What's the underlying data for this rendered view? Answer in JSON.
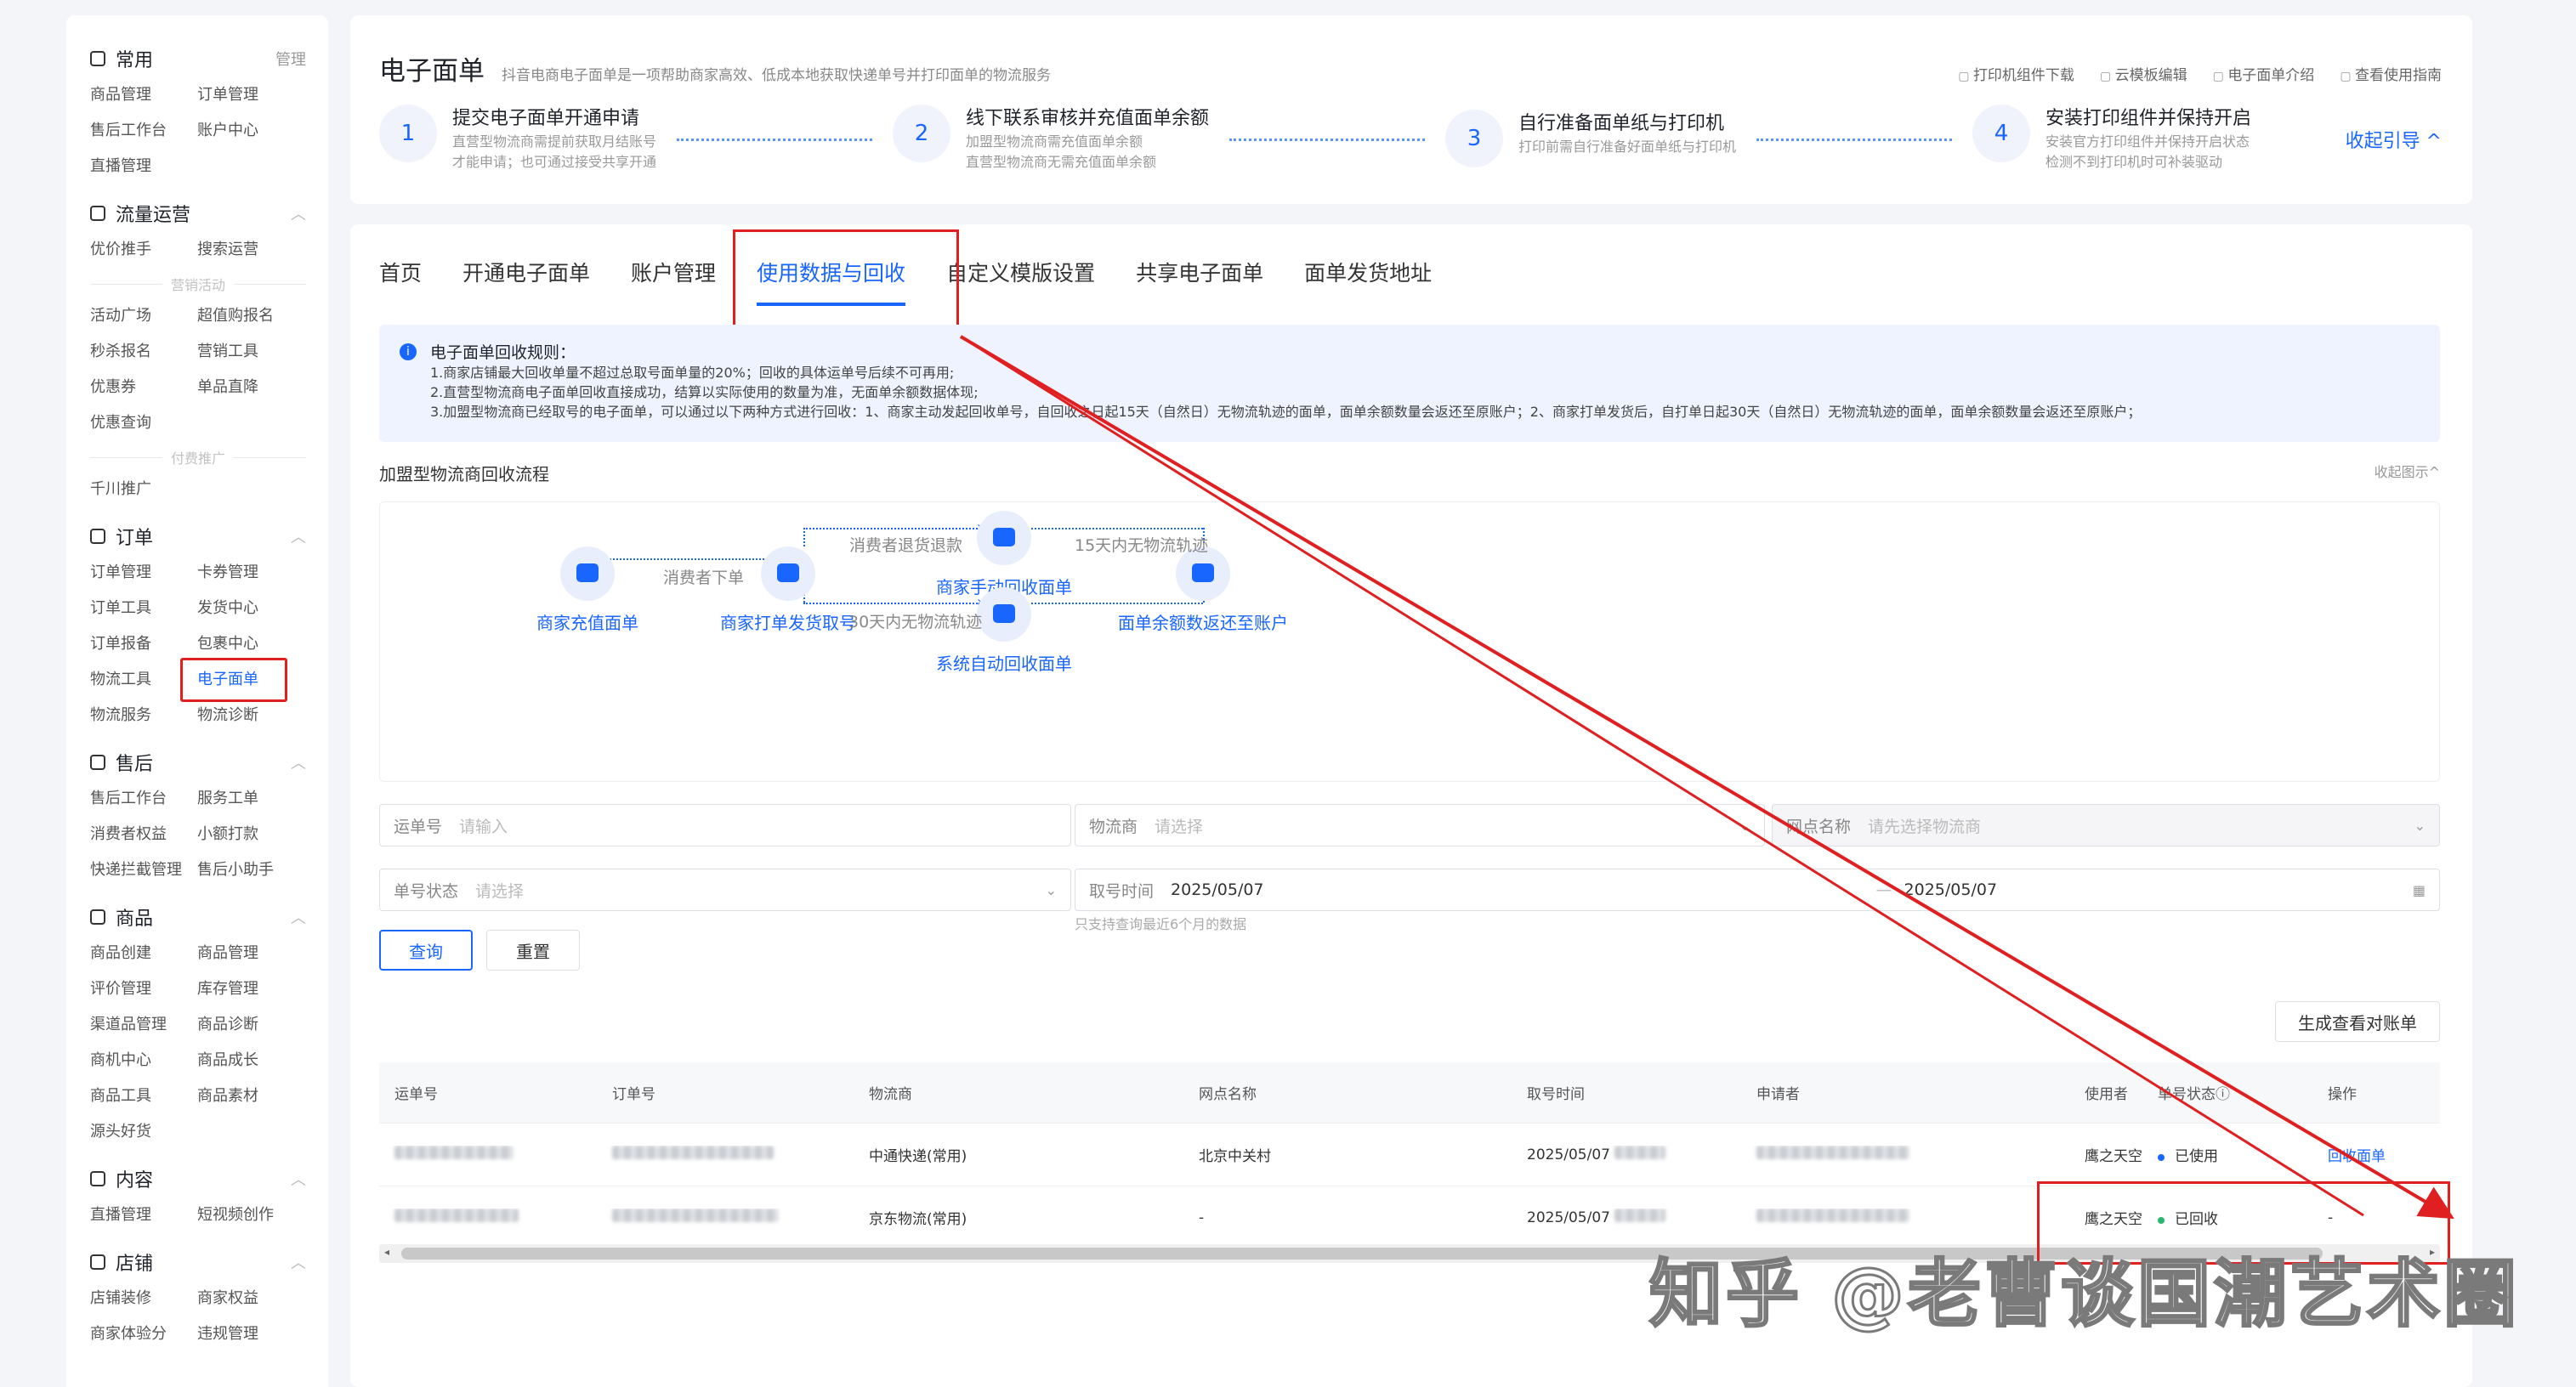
{
  "sidebar": {
    "common": {
      "title": "常用",
      "right": "管理",
      "items": [
        "商品管理",
        "订单管理",
        "售后工作台",
        "账户中心",
        "直播管理"
      ]
    },
    "traffic": {
      "title": "流量运营",
      "items1": [
        "优价推手",
        "搜索运营"
      ],
      "sub1": "营销活动",
      "items2": [
        "活动广场",
        "超值购报名",
        "秒杀报名",
        "营销工具",
        "优惠券",
        "单品直降",
        "优惠查询"
      ],
      "sub2": "付费推广",
      "items3": [
        "千川推广"
      ]
    },
    "order": {
      "title": "订单",
      "items": [
        "订单管理",
        "卡券管理",
        "订单工具",
        "发货中心",
        "订单报备",
        "包裹中心",
        "物流工具",
        "电子面单",
        "物流服务",
        "物流诊断"
      ]
    },
    "aftersale": {
      "title": "售后",
      "items": [
        "售后工作台",
        "服务工单",
        "消费者权益",
        "小额打款",
        "快递拦截管理",
        "售后小助手"
      ]
    },
    "goods": {
      "title": "商品",
      "items": [
        "商品创建",
        "商品管理",
        "评价管理",
        "库存管理",
        "渠道品管理",
        "商品诊断",
        "商机中心",
        "商品成长",
        "商品工具",
        "商品素材",
        "源头好货"
      ]
    },
    "content": {
      "title": "内容",
      "items": [
        "直播管理",
        "短视频创作"
      ]
    },
    "shop": {
      "title": "店铺",
      "items": [
        "店铺装修",
        "商家权益",
        "商家体验分",
        "违规管理"
      ]
    }
  },
  "top": {
    "title": "电子面单",
    "desc": "抖音电商电子面单是一项帮助商家高效、低成本地获取快递单号并打印面单的物流服务",
    "links": [
      "打印机组件下载",
      "云模板编辑",
      "电子面单介绍",
      "查看使用指南"
    ],
    "steps": [
      {
        "num": "1",
        "title": "提交电子面单开通申请",
        "desc1": "直营型物流商需提前获取月结账号",
        "desc2": "才能申请；也可通过接受共享开通"
      },
      {
        "num": "2",
        "title": "线下联系审核并充值面单余额",
        "desc1": "加盟型物流商需充值面单余额",
        "desc2": "直营型物流商无需充值面单余额"
      },
      {
        "num": "3",
        "title": "自行准备面单纸与打印机",
        "desc1": "打印前需自行准备好面单纸与打印机",
        "desc2": ""
      },
      {
        "num": "4",
        "title": "安装打印组件并保持开启",
        "desc1": "安装官方打印组件并保持开启状态",
        "desc2": "检测不到打印机时可补装驱动"
      }
    ],
    "collapse": "收起引导 ^"
  },
  "tabs": [
    "首页",
    "开通电子面单",
    "账户管理",
    "使用数据与回收",
    "自定义模版设置",
    "共享电子面单",
    "面单发货地址"
  ],
  "notice": {
    "title": "电子面单回收规则：",
    "lines": [
      "1.商家店铺最大回收单量不超过总取号面单量的20%；回收的具体运单号后续不可再用;",
      "2.直营型物流商电子面单回收直接成功，结算以实际使用的数量为准，无面单余额数据体现;",
      "3.加盟型物流商已经取号的电子面单，可以通过以下两种方式进行回收：1、商家主动发起回收单号，自回收之日起15天（自然日）无物流轨迹的面单，面单余额数量会返还至原账户；2、商家打单发货后，自打单日起30天（自然日）无物流轨迹的面单，面单余额数量会返还至原账户；"
    ]
  },
  "flow": {
    "title": "加盟型物流商回收流程",
    "collapse": "收起图示^",
    "nodes": {
      "recharge": "商家充值面单",
      "print": "商家打单发货取号",
      "manual": "商家手动回收面单",
      "auto": "系统自动回收面单",
      "return": "面单余额数返还至账户"
    },
    "labels": {
      "order": "消费者下单",
      "refund": "消费者退货退款",
      "no15": "15天内无物流轨迹",
      "no30": "30天内无物流轨迹"
    }
  },
  "filters": {
    "waybill": {
      "label": "运单号",
      "placeholder": "请输入"
    },
    "carrier": {
      "label": "物流商",
      "placeholder": "请选择"
    },
    "site": {
      "label": "网点名称",
      "placeholder": "请先选择物流商"
    },
    "status": {
      "label": "单号状态",
      "placeholder": "请选择"
    },
    "time": {
      "label": "取号时间",
      "start": "2025/05/07",
      "sep": "—",
      "end": "2025/05/07"
    },
    "hint": "只支持查询最近6个月的数据",
    "query": "查询",
    "reset": "重置",
    "bill": "生成查看对账单"
  },
  "table": {
    "headers": [
      "运单号",
      "订单号",
      "物流商",
      "网点名称",
      "取号时间",
      "申请者",
      "使用者",
      "单号状态ⓘ",
      "操作"
    ],
    "rows": [
      {
        "carrier": "中通快递(常用)",
        "site": "北京中关村",
        "time": "2025/05/07",
        "user": "鹰之天空",
        "status": "已使用",
        "status_color": "#1966ff",
        "action": "回收面单"
      },
      {
        "carrier": "京东物流(常用)",
        "site": "-",
        "time": "2025/05/07",
        "user": "鹰之天空",
        "status": "已回收",
        "status_color": "#2bb673",
        "action": "-"
      }
    ]
  },
  "watermark": "知乎 @老曹谈国潮艺术圈",
  "colors": {
    "accent": "#1966ff",
    "annotation": "#e02020"
  }
}
